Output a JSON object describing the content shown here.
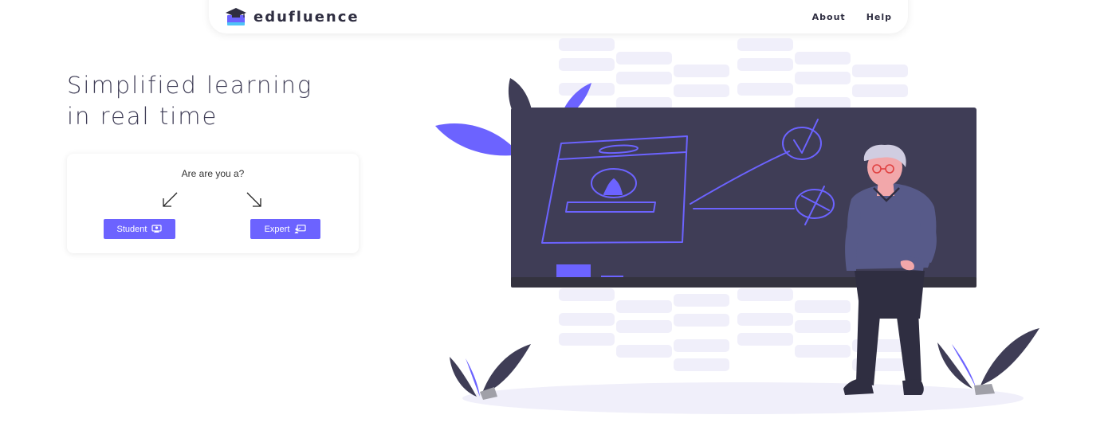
{
  "brand": {
    "name": "edufluence",
    "logo_icon": "graduation-cap-book-icon"
  },
  "nav": {
    "items": [
      {
        "label": "About"
      },
      {
        "label": "Help"
      }
    ]
  },
  "hero": {
    "line1": "Simplified learning",
    "line2": "in real time"
  },
  "role_card": {
    "question": "Are are you a?",
    "student_label": "Student",
    "student_icon": "student-icon",
    "expert_label": "Expert",
    "expert_icon": "teacher-board-icon"
  },
  "colors": {
    "accent": "#6c63ff",
    "dark": "#3f3d56",
    "text": "#2f2e41",
    "light_block": "#f0effa"
  }
}
